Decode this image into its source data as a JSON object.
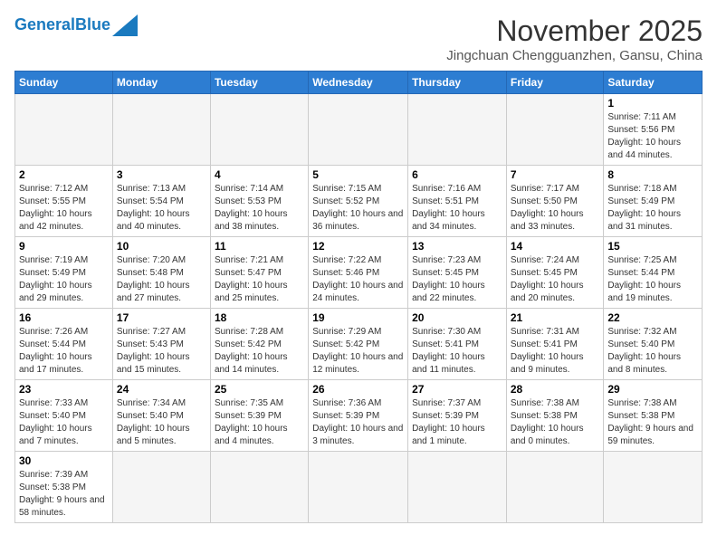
{
  "header": {
    "logo_general": "General",
    "logo_blue": "Blue",
    "month_title": "November 2025",
    "location": "Jingchuan Chengguanzhen, Gansu, China"
  },
  "weekdays": [
    "Sunday",
    "Monday",
    "Tuesday",
    "Wednesday",
    "Thursday",
    "Friday",
    "Saturday"
  ],
  "weeks": [
    [
      {
        "day": "",
        "info": ""
      },
      {
        "day": "",
        "info": ""
      },
      {
        "day": "",
        "info": ""
      },
      {
        "day": "",
        "info": ""
      },
      {
        "day": "",
        "info": ""
      },
      {
        "day": "",
        "info": ""
      },
      {
        "day": "1",
        "info": "Sunrise: 7:11 AM\nSunset: 5:56 PM\nDaylight: 10 hours and 44 minutes."
      }
    ],
    [
      {
        "day": "2",
        "info": "Sunrise: 7:12 AM\nSunset: 5:55 PM\nDaylight: 10 hours and 42 minutes."
      },
      {
        "day": "3",
        "info": "Sunrise: 7:13 AM\nSunset: 5:54 PM\nDaylight: 10 hours and 40 minutes."
      },
      {
        "day": "4",
        "info": "Sunrise: 7:14 AM\nSunset: 5:53 PM\nDaylight: 10 hours and 38 minutes."
      },
      {
        "day": "5",
        "info": "Sunrise: 7:15 AM\nSunset: 5:52 PM\nDaylight: 10 hours and 36 minutes."
      },
      {
        "day": "6",
        "info": "Sunrise: 7:16 AM\nSunset: 5:51 PM\nDaylight: 10 hours and 34 minutes."
      },
      {
        "day": "7",
        "info": "Sunrise: 7:17 AM\nSunset: 5:50 PM\nDaylight: 10 hours and 33 minutes."
      },
      {
        "day": "8",
        "info": "Sunrise: 7:18 AM\nSunset: 5:49 PM\nDaylight: 10 hours and 31 minutes."
      }
    ],
    [
      {
        "day": "9",
        "info": "Sunrise: 7:19 AM\nSunset: 5:49 PM\nDaylight: 10 hours and 29 minutes."
      },
      {
        "day": "10",
        "info": "Sunrise: 7:20 AM\nSunset: 5:48 PM\nDaylight: 10 hours and 27 minutes."
      },
      {
        "day": "11",
        "info": "Sunrise: 7:21 AM\nSunset: 5:47 PM\nDaylight: 10 hours and 25 minutes."
      },
      {
        "day": "12",
        "info": "Sunrise: 7:22 AM\nSunset: 5:46 PM\nDaylight: 10 hours and 24 minutes."
      },
      {
        "day": "13",
        "info": "Sunrise: 7:23 AM\nSunset: 5:45 PM\nDaylight: 10 hours and 22 minutes."
      },
      {
        "day": "14",
        "info": "Sunrise: 7:24 AM\nSunset: 5:45 PM\nDaylight: 10 hours and 20 minutes."
      },
      {
        "day": "15",
        "info": "Sunrise: 7:25 AM\nSunset: 5:44 PM\nDaylight: 10 hours and 19 minutes."
      }
    ],
    [
      {
        "day": "16",
        "info": "Sunrise: 7:26 AM\nSunset: 5:44 PM\nDaylight: 10 hours and 17 minutes."
      },
      {
        "day": "17",
        "info": "Sunrise: 7:27 AM\nSunset: 5:43 PM\nDaylight: 10 hours and 15 minutes."
      },
      {
        "day": "18",
        "info": "Sunrise: 7:28 AM\nSunset: 5:42 PM\nDaylight: 10 hours and 14 minutes."
      },
      {
        "day": "19",
        "info": "Sunrise: 7:29 AM\nSunset: 5:42 PM\nDaylight: 10 hours and 12 minutes."
      },
      {
        "day": "20",
        "info": "Sunrise: 7:30 AM\nSunset: 5:41 PM\nDaylight: 10 hours and 11 minutes."
      },
      {
        "day": "21",
        "info": "Sunrise: 7:31 AM\nSunset: 5:41 PM\nDaylight: 10 hours and 9 minutes."
      },
      {
        "day": "22",
        "info": "Sunrise: 7:32 AM\nSunset: 5:40 PM\nDaylight: 10 hours and 8 minutes."
      }
    ],
    [
      {
        "day": "23",
        "info": "Sunrise: 7:33 AM\nSunset: 5:40 PM\nDaylight: 10 hours and 7 minutes."
      },
      {
        "day": "24",
        "info": "Sunrise: 7:34 AM\nSunset: 5:40 PM\nDaylight: 10 hours and 5 minutes."
      },
      {
        "day": "25",
        "info": "Sunrise: 7:35 AM\nSunset: 5:39 PM\nDaylight: 10 hours and 4 minutes."
      },
      {
        "day": "26",
        "info": "Sunrise: 7:36 AM\nSunset: 5:39 PM\nDaylight: 10 hours and 3 minutes."
      },
      {
        "day": "27",
        "info": "Sunrise: 7:37 AM\nSunset: 5:39 PM\nDaylight: 10 hours and 1 minute."
      },
      {
        "day": "28",
        "info": "Sunrise: 7:38 AM\nSunset: 5:38 PM\nDaylight: 10 hours and 0 minutes."
      },
      {
        "day": "29",
        "info": "Sunrise: 7:38 AM\nSunset: 5:38 PM\nDaylight: 9 hours and 59 minutes."
      }
    ],
    [
      {
        "day": "30",
        "info": "Sunrise: 7:39 AM\nSunset: 5:38 PM\nDaylight: 9 hours and 58 minutes."
      },
      {
        "day": "",
        "info": ""
      },
      {
        "day": "",
        "info": ""
      },
      {
        "day": "",
        "info": ""
      },
      {
        "day": "",
        "info": ""
      },
      {
        "day": "",
        "info": ""
      },
      {
        "day": "",
        "info": ""
      }
    ]
  ]
}
